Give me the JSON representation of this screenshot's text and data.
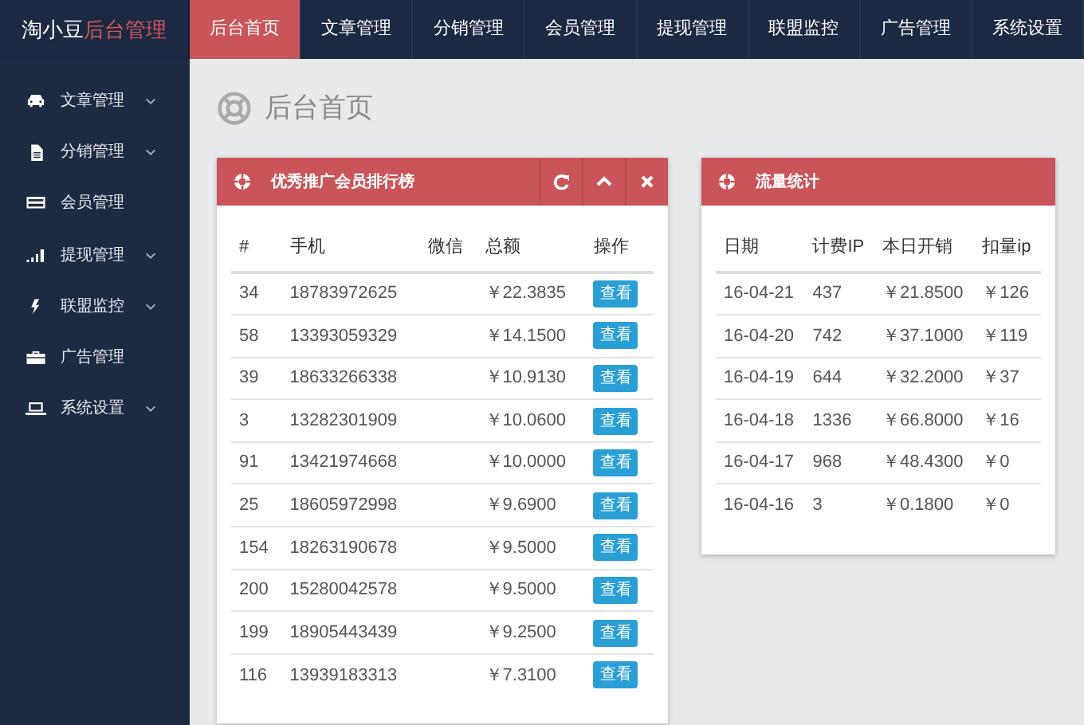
{
  "brand": {
    "name": "淘小豆",
    "suffix": "后台管理"
  },
  "top_nav": [
    {
      "label": "后台首页",
      "selected": true
    },
    {
      "label": "文章管理",
      "selected": false
    },
    {
      "label": "分销管理",
      "selected": false
    },
    {
      "label": "会员管理",
      "selected": false
    },
    {
      "label": "提现管理",
      "selected": false
    },
    {
      "label": "联盟监控",
      "selected": false
    },
    {
      "label": "广告管理",
      "selected": false
    },
    {
      "label": "系统设置",
      "selected": false
    }
  ],
  "sidebar": {
    "items": [
      {
        "label": "文章管理",
        "has_submenu": true
      },
      {
        "label": "分销管理",
        "has_submenu": true
      },
      {
        "label": "会员管理",
        "has_submenu": false
      },
      {
        "label": "提现管理",
        "has_submenu": true
      },
      {
        "label": "联盟监控",
        "has_submenu": true
      },
      {
        "label": "广告管理",
        "has_submenu": false
      },
      {
        "label": "系统设置",
        "has_submenu": true
      }
    ]
  },
  "page_title": "后台首页",
  "panels": [
    {
      "title": "优秀推广会员排行榜",
      "has_tools": true,
      "columns": [
        "#",
        "手机",
        "微信",
        "总额",
        "操作"
      ],
      "rows": [
        [
          "34",
          "18783972625",
          "",
          "￥22.3835",
          "查看"
        ],
        [
          "58",
          "13393059329",
          "",
          "￥14.1500",
          "查看"
        ],
        [
          "39",
          "18633266338",
          "",
          "￥10.9130",
          "查看"
        ],
        [
          "3",
          "13282301909",
          "",
          "￥10.0600",
          "查看"
        ],
        [
          "91",
          "13421974668",
          "",
          "￥10.0000",
          "查看"
        ],
        [
          "25",
          "18605972998",
          "",
          "￥9.6900",
          "查看"
        ],
        [
          "154",
          "18263190678",
          "",
          "￥9.5000",
          "查看"
        ],
        [
          "200",
          "15280042578",
          "",
          "￥9.5000",
          "查看"
        ],
        [
          "199",
          "18905443439",
          "",
          "￥9.2500",
          "查看"
        ],
        [
          "116",
          "13939183313",
          "",
          "￥7.3100",
          "查看"
        ]
      ]
    },
    {
      "title": "流量统计",
      "has_tools": false,
      "columns": [
        "日期",
        "计费IP",
        "本日开销",
        "扣量ip"
      ],
      "rows": [
        [
          "16-04-21",
          "437",
          "￥21.8500",
          "￥126"
        ],
        [
          "16-04-20",
          "742",
          "￥37.1000",
          "￥119"
        ],
        [
          "16-04-19",
          "644",
          "￥32.2000",
          "￥37"
        ],
        [
          "16-04-18",
          "1336",
          "￥66.8000",
          "￥16"
        ],
        [
          "16-04-17",
          "968",
          "￥48.4300",
          "￥0"
        ],
        [
          "16-04-16",
          "3",
          "￥0.1800",
          "￥0"
        ]
      ]
    }
  ]
}
